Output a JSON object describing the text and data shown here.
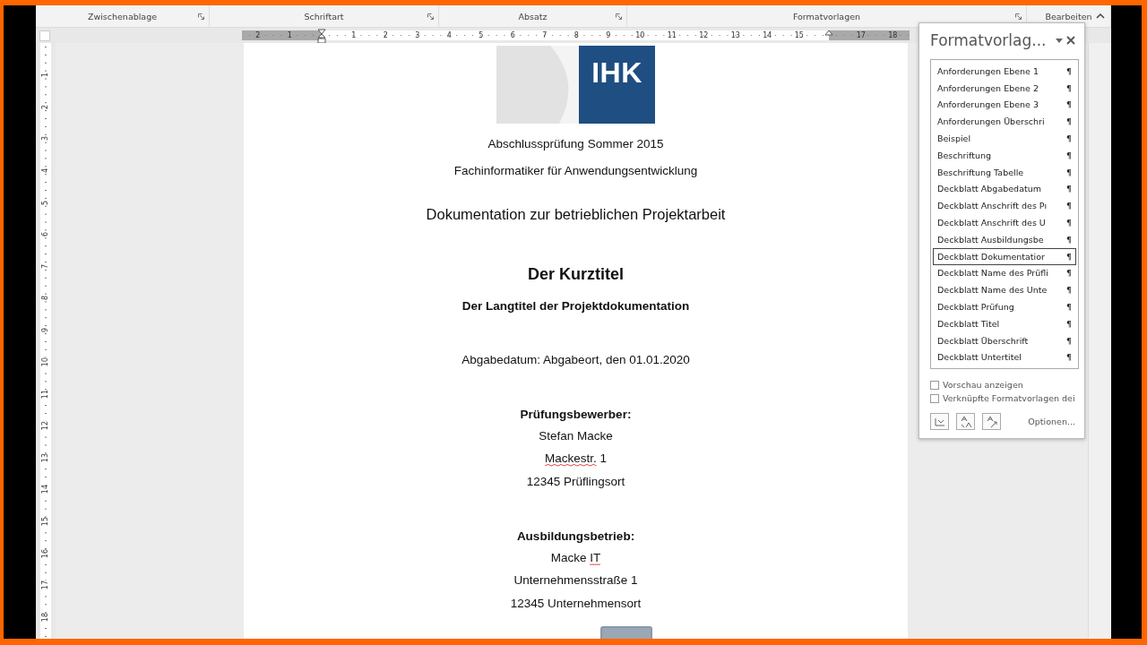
{
  "ribbon": {
    "groups": [
      {
        "label": "Zwischenablage",
        "launcher": true
      },
      {
        "label": "Schriftart",
        "launcher": true
      },
      {
        "label": "Absatz",
        "launcher": true
      },
      {
        "label": "Formatvorlagen",
        "launcher": true
      },
      {
        "label": "Bearbeiten",
        "launcher": false
      }
    ]
  },
  "horizontal_ruler": {
    "left_numbers": [
      "2",
      "1"
    ],
    "numbers": [
      "1",
      "2",
      "3",
      "4",
      "5",
      "6",
      "7",
      "8",
      "9",
      "10",
      "11",
      "12",
      "13",
      "14",
      "15"
    ],
    "right_numbers": [
      "17",
      "18"
    ]
  },
  "vertical_ruler": {
    "numbers": [
      "1",
      "2",
      "3",
      "4",
      "5",
      "6",
      "7",
      "8",
      "9",
      "10",
      "11",
      "12",
      "13",
      "14",
      "15",
      "16",
      "17",
      "18"
    ]
  },
  "logo": {
    "text": "IHK"
  },
  "document": {
    "lines": [
      {
        "kind": "normal",
        "parts": [
          {
            "text": "Abschlussprüfung Sommer 2015",
            "misspelled": false
          }
        ]
      },
      {
        "kind": "normal",
        "parts": [
          {
            "text": "Fachinformatiker für Anwendungsentwicklung",
            "misspelled": false
          }
        ]
      },
      {
        "kind": "subtitle",
        "parts": [
          {
            "text": "Dokumentation zur betrieblichen Projektarbeit",
            "misspelled": false
          }
        ]
      },
      {
        "kind": "title",
        "parts": [
          {
            "text": "Der Kurztitel",
            "misspelled": false
          }
        ]
      },
      {
        "kind": "heading",
        "parts": [
          {
            "text": "Der Langtitel der Projektdokumentation",
            "misspelled": false
          }
        ]
      },
      {
        "kind": "normal",
        "parts": [
          {
            "text": "Abgabedatum: Abgabeort, den 01.01.2020",
            "misspelled": false
          }
        ]
      },
      {
        "kind": "label",
        "parts": [
          {
            "text": "Prüfungsbewerber:",
            "misspelled": false
          }
        ]
      },
      {
        "kind": "normal",
        "parts": [
          {
            "text": "Stefan Macke",
            "misspelled": false
          }
        ]
      },
      {
        "kind": "normal",
        "parts": [
          {
            "text": "Mackestr.",
            "misspelled": true
          },
          {
            "text": " 1",
            "misspelled": false
          }
        ]
      },
      {
        "kind": "normal",
        "parts": [
          {
            "text": "12345 Prüflingsort",
            "misspelled": false
          }
        ]
      },
      {
        "kind": "label",
        "parts": [
          {
            "text": "Ausbildungsbetrieb:",
            "misspelled": false
          }
        ]
      },
      {
        "kind": "normal",
        "parts": [
          {
            "text": "Macke ",
            "misspelled": false
          },
          {
            "text": "IT",
            "misspelled": true
          }
        ]
      },
      {
        "kind": "normal",
        "parts": [
          {
            "text": "Unternehmensstraße 1",
            "misspelled": false
          }
        ]
      },
      {
        "kind": "normal",
        "parts": [
          {
            "text": "12345 Unternehmensort",
            "misspelled": false
          }
        ]
      }
    ]
  },
  "styles_pane": {
    "title": "Formatvorlag...",
    "items": [
      {
        "name": "Anforderungen Ebene 1",
        "mark": "¶",
        "selected": false
      },
      {
        "name": "Anforderungen Ebene 2",
        "mark": "¶",
        "selected": false
      },
      {
        "name": "Anforderungen Ebene 3",
        "mark": "¶",
        "selected": false
      },
      {
        "name": "Anforderungen Überschri",
        "mark": "¶",
        "selected": false
      },
      {
        "name": "Beispiel",
        "mark": "¶",
        "selected": false
      },
      {
        "name": "Beschriftung",
        "mark": "¶",
        "selected": false
      },
      {
        "name": "Beschriftung Tabelle",
        "mark": "¶",
        "selected": false
      },
      {
        "name": "Deckblatt Abgabedatum",
        "mark": "¶",
        "selected": false
      },
      {
        "name": "Deckblatt Anschrift des Pı",
        "mark": "¶",
        "selected": false
      },
      {
        "name": "Deckblatt Anschrift des U",
        "mark": "¶",
        "selected": false
      },
      {
        "name": "Deckblatt Ausbildungsbe",
        "mark": "¶",
        "selected": false
      },
      {
        "name": "Deckblatt Dokumentatior",
        "mark": "¶",
        "selected": true
      },
      {
        "name": "Deckblatt Name des Prüfli",
        "mark": "¶",
        "selected": false
      },
      {
        "name": "Deckblatt Name des Unte",
        "mark": "¶",
        "selected": false
      },
      {
        "name": "Deckblatt Prüfung",
        "mark": "¶",
        "selected": false
      },
      {
        "name": "Deckblatt Titel",
        "mark": "¶",
        "selected": false
      },
      {
        "name": "Deckblatt Überschrift",
        "mark": "¶",
        "selected": false
      },
      {
        "name": "Deckblatt Untertitel",
        "mark": "¶",
        "selected": false
      }
    ],
    "options": [
      {
        "label": "Vorschau anzeigen",
        "checked": false
      },
      {
        "label": "Verknüpfte Formatvorlagen dei",
        "checked": false
      }
    ],
    "options_link": "Optionen..."
  }
}
